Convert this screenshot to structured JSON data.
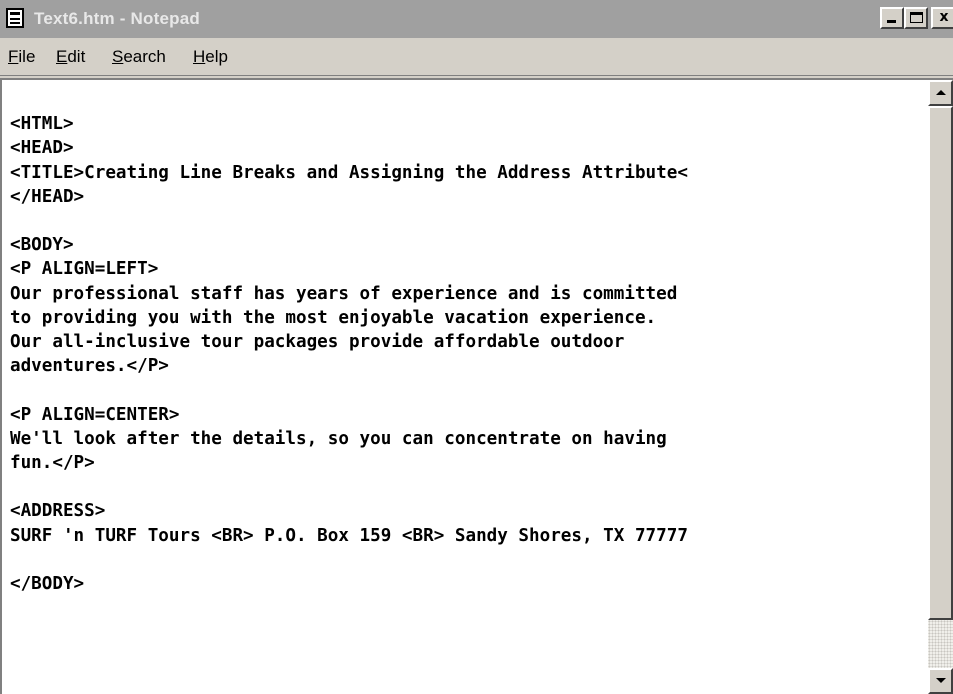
{
  "window": {
    "title": "Text6.htm - Notepad",
    "controls": {
      "minimize_icon": "minimize-icon",
      "maximize_icon": "maximize-icon",
      "close_label": "x"
    }
  },
  "menu": {
    "items": [
      {
        "underline": "F",
        "rest": "ile"
      },
      {
        "underline": "E",
        "rest": "dit"
      },
      {
        "underline": "S",
        "rest": "earch"
      },
      {
        "underline": "H",
        "rest": "elp"
      }
    ]
  },
  "editor": {
    "text": "\n<HTML>\n<HEAD>\n<TITLE>Creating Line Breaks and Assigning the Address Attribute<\n</HEAD>\n\n<BODY>\n<P ALIGN=LEFT>\nOur professional staff has years of experience and is committed\nto providing you with the most enjoyable vacation experience.\nOur all-inclusive tour packages provide affordable outdoor\nadventures.</P>\n\n<P ALIGN=CENTER>\nWe'll look after the details, so you can concentrate on having\nfun.</P>\n\n<ADDRESS>\nSURF 'n TURF Tours <BR> P.O. Box 159 <BR> Sandy Shores, TX 77777\n\n</BODY>"
  },
  "colors": {
    "titlebar_inactive": "#a0a0a0",
    "chrome": "#d4d0c8",
    "editor_bg": "#ffffff"
  }
}
